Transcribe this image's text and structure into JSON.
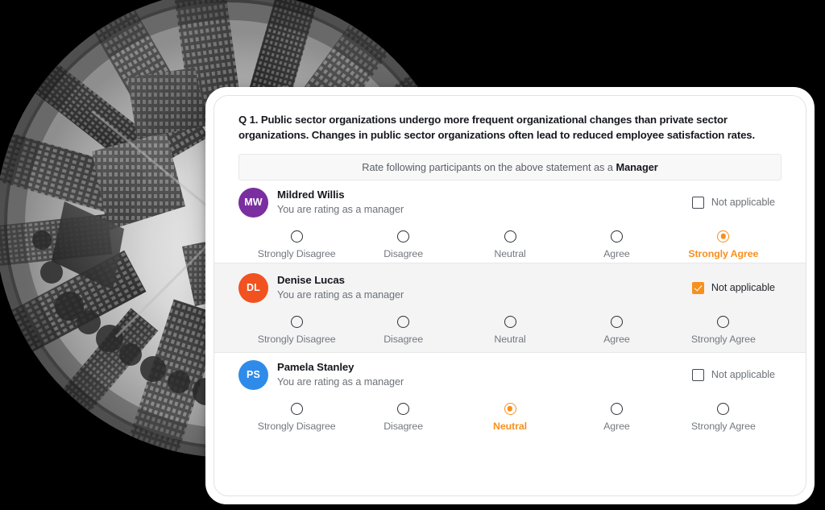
{
  "question": {
    "text": "Q 1. Public sector organizations undergo more frequent organizational changes than private sector organizations. Changes in public sector organizations often lead to reduced employee satisfaction rates."
  },
  "instruction": {
    "prefix": "Rate following participants on the above statement as a ",
    "role": "Manager"
  },
  "scale_labels": [
    "Strongly Disagree",
    "Disagree",
    "Neutral",
    "Agree",
    "Strongly Agree"
  ],
  "not_applicable_label": "Not applicable",
  "role_subtitle": "You are rating as a manager",
  "colors": {
    "accent_orange": "#f7901e",
    "avatar_purple": "#7a2ea0",
    "avatar_orange": "#f1521f",
    "avatar_blue": "#2e8bea",
    "row_highlight": "#f4f4f5",
    "instruction_bg": "#f8f8f9",
    "text_dark": "#16181d",
    "text_muted": "#6d7178"
  },
  "participants": [
    {
      "name": "Mildred Willis",
      "initials": "MW",
      "role": "You are rating as a manager",
      "avatar_color": "#7a2ea0",
      "not_applicable": false,
      "not_applicable_label": "Not applicable",
      "selected_index": 4,
      "selected_label": "Strongly Agree",
      "highlighted": false,
      "labels": [
        "Strongly Disagree",
        "Disagree",
        "Neutral",
        "Agree",
        "Strongly Agree"
      ]
    },
    {
      "name": "Denise Lucas",
      "initials": "DL",
      "role": "You are rating as a manager",
      "avatar_color": "#f1521f",
      "not_applicable": true,
      "not_applicable_label": "Not applicable",
      "selected_index": -1,
      "selected_label": "",
      "highlighted": true,
      "labels": [
        "Strongly Disagree",
        "Disagree",
        "Neutral",
        "Agree",
        "Strongly Agree"
      ]
    },
    {
      "name": "Pamela Stanley",
      "initials": "PS",
      "role": "You are rating as a manager",
      "avatar_color": "#2e8bea",
      "not_applicable": false,
      "not_applicable_label": "Not applicable",
      "selected_index": 2,
      "selected_label": "Neutral",
      "highlighted": false,
      "labels": [
        "Strongly Disagree",
        "Disagree",
        "Neutral",
        "Agree",
        "Strongly Agree"
      ]
    }
  ],
  "background_image": {
    "description": "circular black and white fisheye tiny-planet aerial cityscape photograph"
  }
}
